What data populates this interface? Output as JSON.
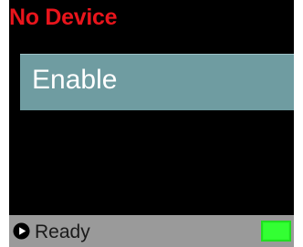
{
  "screen": {
    "title": "No Device",
    "title_color": "#e8151c",
    "background_color": "#000000"
  },
  "menu": {
    "items": [
      {
        "label": "Enable",
        "selected": true,
        "highlight_color": "#6f9ca1"
      }
    ]
  },
  "status_bar": {
    "icon": "play-icon",
    "status_text": "Ready",
    "battery": {
      "icon": "battery-icon",
      "level": 1.0,
      "color": "#2bff2b"
    }
  }
}
